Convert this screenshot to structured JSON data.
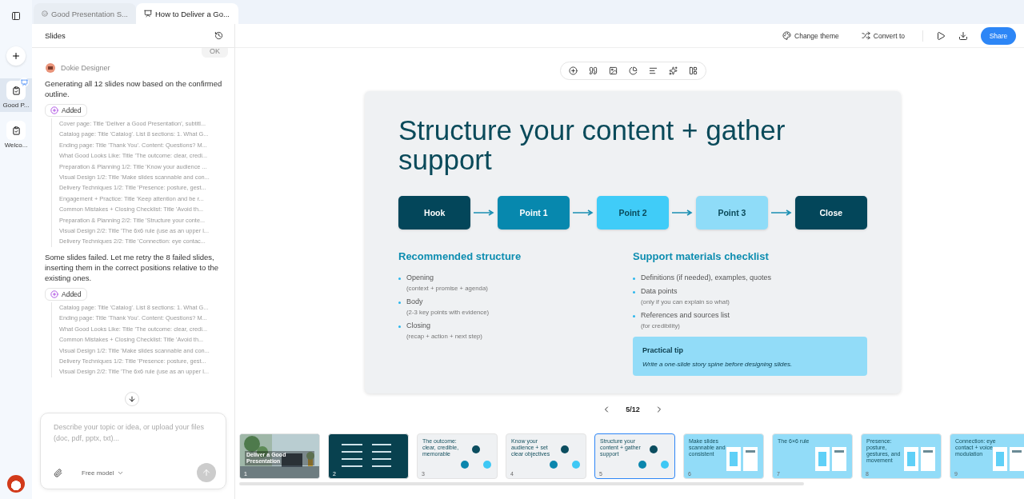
{
  "rail": {
    "projects": [
      {
        "label": "Good P...",
        "selected": true,
        "badge": true
      },
      {
        "label": "Welco...",
        "selected": false,
        "badge": false
      }
    ]
  },
  "tabs": [
    {
      "label": "Good Presentation S...",
      "selected": false,
      "kind": "bot"
    },
    {
      "label": "How to Deliver a Go...",
      "selected": true,
      "kind": "slides"
    }
  ],
  "chat": {
    "title": "Slides",
    "ok": "OK",
    "sender": "Dokie Designer",
    "blocks": [
      {
        "message": "Generating all 12 slides now based on the confirmed outline.",
        "status": "Added",
        "items": [
          "Cover page: Title 'Deliver a Good Presentation', subtitl...",
          "Catalog page: Title 'Catalog'. List 8 sections: 1. What G...",
          "Ending page: Title 'Thank You'. Content: Questions? M...",
          "What Good Looks Like: Title 'The outcome: clear, credi...",
          "Preparation & Planning 1/2: Title 'Know your audience ...",
          "Visual Design 1/2: Title 'Make slides scannable and con...",
          "Delivery Techniques 1/2: Title 'Presence: posture, gest...",
          "Engagement + Practice: Title 'Keep attention and be r...",
          "Common Mistakes + Closing Checklist: Title 'Avoid th...",
          "Preparation & Planning 2/2: Title 'Structure your conte...",
          "Visual Design 2/2: Title 'The 6x6 rule (use as an upper l...",
          "Delivery Techniques 2/2: Title 'Connection: eye contac..."
        ]
      },
      {
        "message": "Some slides failed. Let me retry the 8 failed slides, inserting them in the correct positions relative to the existing ones.",
        "status": "Added",
        "items": [
          "Catalog page: Title 'Catalog'. List 8 sections: 1. What G...",
          "Ending page: Title 'Thank You'. Content: Questions? M...",
          "What Good Looks Like: Title 'The outcome: clear, credi...",
          "Common Mistakes + Closing Checklist: Title 'Avoid th...",
          "Visual Design 1/2: Title 'Make slides scannable and con...",
          "Delivery Techniques 1/2: Title 'Presence: posture, gest...",
          "Visual Design 2/2: Title 'The 6x6 rule (use as an upper l..."
        ]
      }
    ],
    "input": {
      "placeholder": "Describe your topic or idea, or upload your files (doc, pdf, pptx, txt)...",
      "model": "Free model"
    }
  },
  "header": {
    "buttons": [
      "Change theme",
      "Convert to"
    ],
    "share": "Share"
  },
  "slide": {
    "title": "Structure your content + gather support",
    "flow": [
      {
        "label": "Hook",
        "color": "#03465a"
      },
      {
        "label": "Point 1",
        "color": "#0788ae"
      },
      {
        "label": "Point 2",
        "color": "#40ccf8"
      },
      {
        "label": "Point 3",
        "color": "#8fdcf8"
      },
      {
        "label": "Close",
        "color": "#03465a"
      }
    ],
    "sections": [
      {
        "heading": "Recommended structure",
        "items": [
          {
            "text": "Opening",
            "note": "(context + promise + agenda)"
          },
          {
            "text": "Body",
            "note": "(2-3 key points with evidence)"
          },
          {
            "text": "Closing",
            "note": "(recap + action + next step)"
          }
        ]
      },
      {
        "heading": "Support materials checklist",
        "items": [
          {
            "text": "Definitions (if needed), examples, quotes"
          },
          {
            "text": "Data points",
            "note": "(only if you can explain so what)"
          },
          {
            "text": "References and sources list",
            "note": "(for credibility)"
          }
        ]
      }
    ],
    "tip": {
      "title": "Practical tip",
      "text": "Write a one-slide story spine before designing slides."
    }
  },
  "pager": "5/12",
  "thumbnails": [
    {
      "number": "1",
      "title": "Deliver a Good Presentation",
      "selected": false
    },
    {
      "number": "2",
      "kind": "dark",
      "selected": false
    },
    {
      "number": "3",
      "title": "The outcome: clear, credible, memorable",
      "kind": "light",
      "selected": false
    },
    {
      "number": "4",
      "title": "Know your audience + set clear objectives",
      "kind": "light",
      "selected": false
    },
    {
      "number": "5",
      "title": "Structure your content + gather support",
      "kind": "light",
      "selected": true
    },
    {
      "number": "6",
      "title": "Make slides scannable and consistent",
      "kind": "blue",
      "selected": false
    },
    {
      "number": "7",
      "title": "The 6×6 rule",
      "kind": "blue",
      "selected": false
    },
    {
      "number": "8",
      "title": "Presence: posture, gestures, and movement",
      "kind": "blue",
      "selected": false
    },
    {
      "number": "9",
      "title": "Connection: eye contact + voice modulation",
      "kind": "blue",
      "selected": false
    }
  ]
}
